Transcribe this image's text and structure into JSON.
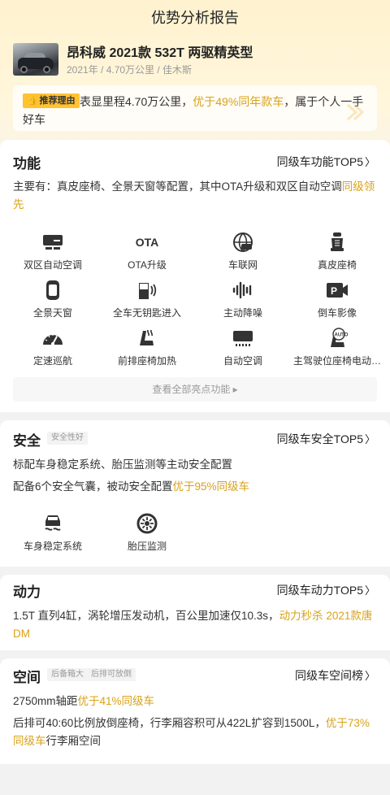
{
  "header": {
    "title": "优势分析报告"
  },
  "car": {
    "name": "昂科威 2021款 532T 两驱精英型",
    "meta": "2021年 / 4.70万公里 / 佳木斯"
  },
  "reason": {
    "badge": "推荐理由",
    "text_1": "表显里程4.70万公里，",
    "text_hl": "优于49%同年款车",
    "text_2": "，属于个人一手好车"
  },
  "function": {
    "title": "功能",
    "link": "同级车功能TOP5",
    "desc_1": "主要有：真皮座椅、全景天窗等配置，其中OTA升级和双区自动空调",
    "desc_hl": "同级领先",
    "items": [
      {
        "label": "双区自动空调",
        "icon": "dual-zone-ac-icon"
      },
      {
        "label": "OTA升级",
        "icon": "ota-icon"
      },
      {
        "label": "车联网",
        "icon": "connected-car-icon"
      },
      {
        "label": "真皮座椅",
        "icon": "leather-seat-icon"
      },
      {
        "label": "全景天窗",
        "icon": "panoramic-sunroof-icon"
      },
      {
        "label": "全车无钥匙进入",
        "icon": "keyless-entry-icon"
      },
      {
        "label": "主动降噪",
        "icon": "noise-cancel-icon"
      },
      {
        "label": "倒车影像",
        "icon": "reverse-camera-icon"
      },
      {
        "label": "定速巡航",
        "icon": "cruise-control-icon"
      },
      {
        "label": "前排座椅加热",
        "icon": "seat-heating-icon"
      },
      {
        "label": "自动空调",
        "icon": "auto-ac-icon"
      },
      {
        "label": "主驾驶位座椅电动…",
        "icon": "power-seat-icon"
      }
    ],
    "more": "查看全部亮点功能 ▸"
  },
  "safety": {
    "title": "安全",
    "tag": "安全性好",
    "link": "同级车安全TOP5",
    "desc_line1": "标配车身稳定系统、胎压监测等主动安全配置",
    "desc_line2_a": "配备6个安全气囊，被动安全配置",
    "desc_line2_hl": "优于95%同级车",
    "items": [
      {
        "label": "车身稳定系统",
        "icon": "stability-control-icon"
      },
      {
        "label": "胎压监测",
        "icon": "tire-pressure-icon"
      }
    ]
  },
  "power": {
    "title": "动力",
    "link": "同级车动力TOP5",
    "desc_a": "1.5T 直列4缸，涡轮增压发动机，百公里加速仅10.3s，",
    "desc_hl": "动力秒杀 2021款唐DM"
  },
  "space": {
    "title": "空间",
    "tag1": "后备箱大",
    "tag2": "后排可放倒",
    "link": "同级车空间榜",
    "line1_a": "2750mm轴距",
    "line1_hl": "优于41%同级车",
    "line2_a": "后排可40:60比例放倒座椅，行李厢容积可从422L扩容到1500L，",
    "line2_hl": "优于73%同级车",
    "line2_b": "行李厢空间"
  },
  "colors": {
    "accent": "#d9a21a",
    "badge": "#ffc233"
  }
}
